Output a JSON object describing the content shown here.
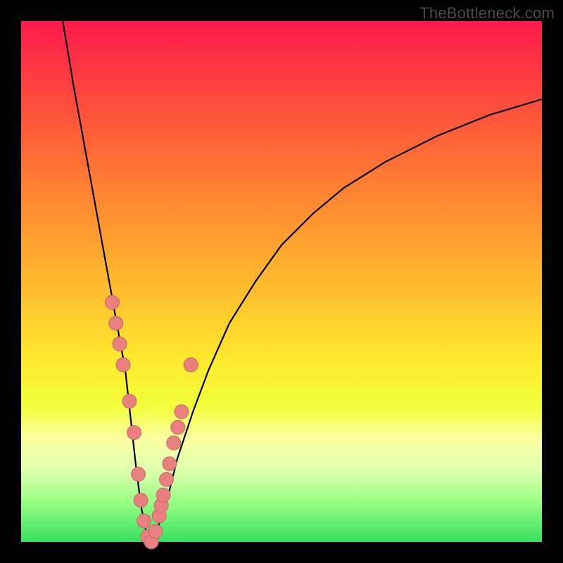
{
  "watermark": "TheBottleneck.com",
  "colors": {
    "frame": "#000000",
    "curve": "#000000",
    "beads": "#e98080",
    "bead_stroke": "#c96a6a"
  },
  "chart_data": {
    "type": "line",
    "title": "",
    "xlabel": "",
    "ylabel": "",
    "xlim": [
      0,
      100
    ],
    "ylim": [
      0,
      100
    ],
    "background_gradient": [
      "#ff1a4b",
      "#ffe92e",
      "#38e060"
    ],
    "description": "V-shaped bottleneck curve with minimum near x≈24. Value represents bottleneck percentage (0 = green bottom, 100 = red top). Pink bead markers cluster along the lower portion of both arms of the V.",
    "series": [
      {
        "name": "bottleneck-curve",
        "x": [
          8,
          10,
          12,
          14,
          16,
          18,
          20,
          22,
          23,
          24,
          25,
          26,
          28,
          30,
          33,
          36,
          40,
          45,
          50,
          56,
          62,
          70,
          80,
          90,
          100
        ],
        "values": [
          100,
          88,
          77,
          66,
          55,
          44,
          33,
          15,
          7,
          2,
          0,
          2,
          8,
          16,
          25,
          33,
          42,
          50,
          57,
          63,
          68,
          73,
          78,
          82,
          85
        ]
      }
    ],
    "markers": {
      "name": "sample-beads",
      "x": [
        17.5,
        18.2,
        18.9,
        19.6,
        20.8,
        21.7,
        22.5,
        23.0,
        23.6,
        24.3,
        25.0,
        25.8,
        26.5,
        26.9,
        27.3,
        27.9,
        28.5,
        29.3,
        30.1,
        30.8,
        32.6
      ],
      "values": [
        46,
        42,
        38,
        34,
        27,
        21,
        13,
        8,
        4,
        1,
        0,
        2,
        5,
        7,
        9,
        12,
        15,
        19,
        22,
        25,
        34
      ]
    }
  }
}
